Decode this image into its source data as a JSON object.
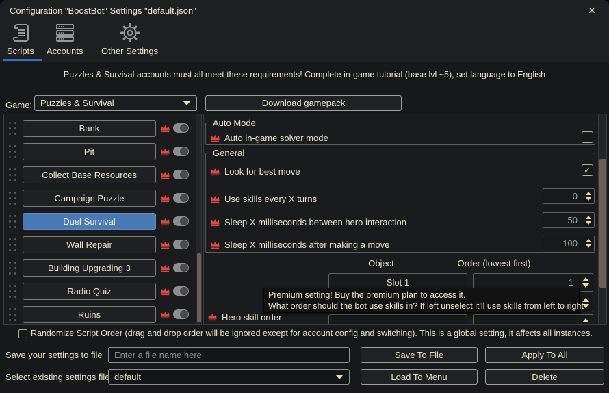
{
  "window": {
    "title": "Configuration \"BoostBot\" Settings \"default.json\""
  },
  "icons": {
    "close": "✕",
    "check": "✓"
  },
  "tabs": {
    "items": [
      {
        "label": "Scripts"
      },
      {
        "label": "Accounts"
      },
      {
        "label": "Other Settings"
      }
    ],
    "active": "Scripts"
  },
  "banner": {
    "text": "Puzzles & Survival accounts must all meet these requirements! Complete in-game tutorial (base lvl ~5), set language to English"
  },
  "game_row": {
    "label": "Game:",
    "selected_game": "Puzzles & Survival",
    "download_button": "Download gamepack"
  },
  "script_list": {
    "items": [
      {
        "name": "Bank",
        "premium": true,
        "enabled": false
      },
      {
        "name": "Pit",
        "premium": true,
        "enabled": false
      },
      {
        "name": "Collect Base Resources",
        "premium": true,
        "enabled": false
      },
      {
        "name": "Campaign Puzzle",
        "premium": true,
        "enabled": false
      },
      {
        "name": "Duel Survival",
        "premium": true,
        "enabled": false,
        "selected": true
      },
      {
        "name": "Wall Repair",
        "premium": true,
        "enabled": false
      },
      {
        "name": "Building Upgrading 3",
        "premium": true,
        "enabled": false
      },
      {
        "name": "Radio Quiz",
        "premium": true,
        "enabled": false
      },
      {
        "name": "Ruins",
        "premium": true,
        "enabled": false
      }
    ]
  },
  "auto_mode_group": {
    "title": "Auto Mode",
    "solver_label": "Auto in-game solver mode",
    "solver_checked": false
  },
  "general_group": {
    "title": "General",
    "best_move_label": "Look for best move",
    "best_move_checked": true,
    "skills_label": "Use skills every X turns",
    "skills_value": "0",
    "sleep_hero_label": "Sleep X milliseconds between hero interaction",
    "sleep_hero_value": "50",
    "sleep_move_label": "Sleep X milliseconds after making a move",
    "sleep_move_value": "100"
  },
  "skill_table": {
    "col_object": "Object",
    "col_order": "Order (lowest first)",
    "rows": [
      {
        "object": "Slot 1",
        "order": "-1"
      },
      {
        "object": "",
        "order": ""
      },
      {
        "object": "",
        "order": ""
      }
    ],
    "hero_label": "Hero skill order"
  },
  "tooltip": {
    "line1": "Premium setting! Buy the premium plan to access it.",
    "line2": "What order should the bot use skills in? If left unselect it'll use skills from left to right"
  },
  "footer": {
    "randomize_label": "Randomize Script Order (drag and drop order will be ignored except for account config and switching). This is a global setting, it affects all instances.",
    "save_label": "Save your settings to file",
    "file_placeholder": "Enter a file name here",
    "save_button": "Save To File",
    "apply_button": "Apply To All",
    "select_label": "Select existing settings file",
    "selected_file": "default",
    "load_button": "Load To Menu",
    "delete_button": "Delete"
  },
  "colors": {
    "accent_blue": "#4a7ab5",
    "premium_red": "#e04646",
    "text_cream": "#e9e2cf",
    "scrollbar_thumb": "#6c5f56"
  }
}
